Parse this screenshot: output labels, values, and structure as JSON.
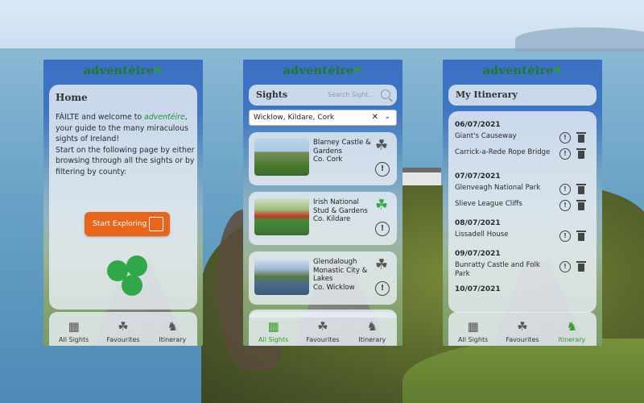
{
  "brand": "adventéire",
  "tabs": [
    {
      "label": "All Sights",
      "icon": "map-icon"
    },
    {
      "label": "Favourites",
      "icon": "shamrock-outline-icon"
    },
    {
      "label": "Itinerary",
      "icon": "ireland-map-icon"
    }
  ],
  "home": {
    "title": "Home",
    "text_prefix": "FÁILTE and welcome to ",
    "text_brand": "adventéire",
    "text_suffix": ", your guide to the many miraculous sights of Ireland!",
    "text2": "Start on the following page by either browsing through all the sights or by filtering by county:",
    "button_label": "Start Exploring"
  },
  "sights": {
    "title": "Sights",
    "search_placeholder": "Search Sight...",
    "filter_value": "Wicklow, Kildare, Cork",
    "items": [
      {
        "name": "Blarney Castle & Gardens",
        "county": "Co. Cork",
        "favourite": false
      },
      {
        "name": "Irish National Stud & Gardens",
        "county": "Co. Kildare",
        "favourite": true
      },
      {
        "name": "Glendalough Monastic City & Lakes",
        "county": "Co. Wicklow",
        "favourite": false
      }
    ]
  },
  "itinerary": {
    "title": "My Itinerary",
    "days": [
      {
        "date": "06/07/2021",
        "items": [
          "Giant's Causeway",
          "Carrick-a-Rede Rope Bridge"
        ]
      },
      {
        "date": "07/07/2021",
        "items": [
          "Glenveagh National Park",
          "Slieve League Cliffs"
        ]
      },
      {
        "date": "08/07/2021",
        "items": [
          "Lissadell House"
        ]
      },
      {
        "date": "09/07/2021",
        "items": [
          "Bunratty Castle and Folk Park"
        ]
      },
      {
        "date": "10/07/2021",
        "items": []
      }
    ]
  },
  "colors": {
    "accent": "#e8661c",
    "brand_green": "#2fa84a",
    "header_blue": "#3b6fc4"
  }
}
